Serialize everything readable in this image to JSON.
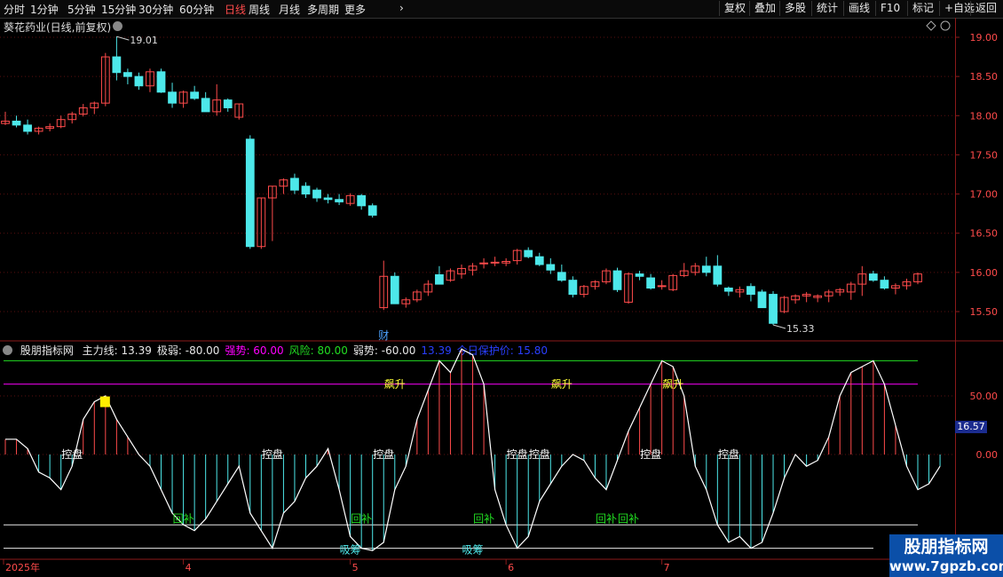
{
  "toolbar": {
    "periods": [
      "分时",
      "1分钟",
      "5分钟",
      "15分钟",
      "30分钟",
      "60分钟",
      "日线",
      "周线",
      "月线",
      "多周期",
      "更多"
    ],
    "active_period": "日线",
    "more_icon": "chevron-right-icon",
    "buttons": [
      "复权",
      "叠加",
      "多股",
      "统计",
      "画线",
      "F10",
      "标记",
      "+自选",
      "返回"
    ]
  },
  "stock": {
    "title": "葵花药业(日线,前复权)",
    "high_label": "19.01",
    "low_label": "15.33",
    "event_label": "财"
  },
  "indicator": {
    "name": "股朋指标网",
    "items": [
      {
        "label": "主力线: 13.39",
        "color": "#e8e8e8"
      },
      {
        "label": "极弱: -80.00",
        "color": "#e8e8e8"
      },
      {
        "label": "强势: 60.00",
        "color": "#ff00ff"
      },
      {
        "label": "风险: 80.00",
        "color": "#22dd22"
      },
      {
        "label": "弱势: -60.00",
        "color": "#e8e8e8"
      },
      {
        "label": "13.39",
        "color": "#2a3fff"
      },
      {
        "label": "今日保护价: 15.80",
        "color": "#2a3fff"
      }
    ],
    "current_value_badge": "16.57",
    "signal_labels": [
      {
        "text": "控盘",
        "i": 6,
        "color": "#ffffff",
        "row": "ctrl"
      },
      {
        "text": "控盘",
        "i": 24,
        "color": "#ffffff",
        "row": "ctrl"
      },
      {
        "text": "控盘",
        "i": 34,
        "color": "#ffffff",
        "row": "ctrl"
      },
      {
        "text": "控盘",
        "i": 46,
        "color": "#ffffff",
        "row": "ctrl"
      },
      {
        "text": "控盘",
        "i": 48,
        "color": "#ffffff",
        "row": "ctrl"
      },
      {
        "text": "控盘",
        "i": 58,
        "color": "#ffffff",
        "row": "ctrl"
      },
      {
        "text": "控盘",
        "i": 65,
        "color": "#ffffff",
        "row": "ctrl"
      },
      {
        "text": "回补",
        "i": 16,
        "color": "#22dd22",
        "row": "hb"
      },
      {
        "text": "回补",
        "i": 32,
        "color": "#22dd22",
        "row": "hb"
      },
      {
        "text": "回补",
        "i": 43,
        "color": "#22dd22",
        "row": "hb"
      },
      {
        "text": "回补",
        "i": 54,
        "color": "#22dd22",
        "row": "hb"
      },
      {
        "text": "回补",
        "i": 56,
        "color": "#22dd22",
        "row": "hb"
      },
      {
        "text": "吸筹",
        "i": 31,
        "color": "#4de8ea",
        "row": "xc"
      },
      {
        "text": "吸筹",
        "i": 42,
        "color": "#4de8ea",
        "row": "xc"
      },
      {
        "text": "飙升",
        "i": 35,
        "color": "#ffff33",
        "row": "bs"
      },
      {
        "text": "飙升",
        "i": 50,
        "color": "#ffff33",
        "row": "bs"
      },
      {
        "text": "飙升",
        "i": 60,
        "color": "#ffff33",
        "row": "bs"
      }
    ]
  },
  "x_axis": {
    "labels": [
      {
        "text": "2025年",
        "i": 0
      },
      {
        "text": "4",
        "i": 16
      },
      {
        "text": "5",
        "i": 31
      },
      {
        "text": "6",
        "i": 45
      },
      {
        "text": "7",
        "i": 59
      }
    ]
  },
  "watermark": {
    "line1": "股朋指标网",
    "line2": "www.7gpzb.com"
  },
  "colors": {
    "up": "#ff4b4b",
    "down": "#4de8ea",
    "bg": "#000000",
    "grid": "#5a0f0f"
  },
  "chart_data": [
    {
      "type": "candlestick",
      "title": "葵花药业(日线,前复权)",
      "y_ticks": [
        19.0,
        18.5,
        18.0,
        17.5,
        17.0,
        16.5,
        16.0,
        15.5
      ],
      "ylim": [
        15.2,
        19.15
      ],
      "ohlc": [
        [
          17.9,
          18.05,
          17.88,
          17.93
        ],
        [
          17.93,
          18.0,
          17.85,
          17.88
        ],
        [
          17.88,
          17.95,
          17.76,
          17.8
        ],
        [
          17.8,
          17.86,
          17.76,
          17.84
        ],
        [
          17.84,
          17.9,
          17.8,
          17.86
        ],
        [
          17.86,
          18.0,
          17.84,
          17.95
        ],
        [
          17.95,
          18.05,
          17.9,
          18.02
        ],
        [
          18.02,
          18.15,
          17.99,
          18.1
        ],
        [
          18.1,
          18.18,
          18.02,
          18.16
        ],
        [
          18.16,
          18.8,
          18.12,
          18.75
        ],
        [
          18.75,
          19.01,
          18.45,
          18.55
        ],
        [
          18.55,
          18.6,
          18.4,
          18.5
        ],
        [
          18.5,
          18.55,
          18.33,
          18.38
        ],
        [
          18.38,
          18.6,
          18.3,
          18.56
        ],
        [
          18.56,
          18.6,
          18.29,
          18.3
        ],
        [
          18.3,
          18.42,
          18.1,
          18.16
        ],
        [
          18.16,
          18.32,
          18.1,
          18.3
        ],
        [
          18.3,
          18.38,
          18.2,
          18.22
        ],
        [
          18.22,
          18.3,
          18.05,
          18.05
        ],
        [
          18.05,
          18.4,
          18.0,
          18.2
        ],
        [
          18.2,
          18.22,
          18.05,
          18.1
        ],
        [
          17.98,
          18.15,
          17.95,
          18.15
        ],
        [
          17.7,
          17.75,
          16.3,
          16.33
        ],
        [
          16.33,
          16.95,
          16.3,
          16.95
        ],
        [
          16.95,
          17.1,
          16.4,
          17.1
        ],
        [
          17.1,
          17.2,
          17.0,
          17.18
        ],
        [
          17.2,
          17.26,
          17.0,
          17.05
        ],
        [
          17.1,
          17.15,
          16.95,
          17.0
        ],
        [
          17.05,
          17.08,
          16.9,
          16.95
        ],
        [
          16.95,
          17.0,
          16.88,
          16.93
        ],
        [
          16.93,
          17.0,
          16.86,
          16.9
        ],
        [
          16.88,
          17.01,
          16.85,
          16.98
        ],
        [
          16.98,
          17.0,
          16.8,
          16.85
        ],
        [
          16.85,
          16.88,
          16.7,
          16.73
        ],
        [
          15.55,
          16.15,
          15.52,
          15.95
        ],
        [
          15.95,
          16.0,
          15.6,
          15.6
        ],
        [
          15.6,
          15.68,
          15.55,
          15.65
        ],
        [
          15.65,
          15.78,
          15.62,
          15.75
        ],
        [
          15.75,
          15.9,
          15.7,
          15.85
        ],
        [
          15.97,
          16.08,
          15.88,
          15.85
        ],
        [
          15.9,
          16.05,
          15.88,
          16.02
        ],
        [
          15.98,
          16.1,
          15.92,
          16.05
        ],
        [
          16.03,
          16.12,
          15.96,
          16.08
        ],
        [
          16.12,
          16.18,
          16.05,
          16.12
        ],
        [
          16.12,
          16.2,
          16.08,
          16.13
        ],
        [
          16.12,
          16.18,
          16.08,
          16.14
        ],
        [
          16.15,
          16.3,
          16.1,
          16.28
        ],
        [
          16.28,
          16.32,
          16.18,
          16.2
        ],
        [
          16.2,
          16.25,
          16.08,
          16.1
        ],
        [
          16.1,
          16.18,
          15.98,
          16.03
        ],
        [
          16.0,
          16.1,
          15.88,
          15.9
        ],
        [
          15.9,
          15.95,
          15.68,
          15.72
        ],
        [
          15.72,
          15.84,
          15.68,
          15.82
        ],
        [
          15.82,
          15.9,
          15.78,
          15.88
        ],
        [
          15.88,
          16.05,
          15.85,
          16.02
        ],
        [
          16.02,
          16.06,
          15.75,
          15.78
        ],
        [
          15.62,
          16.0,
          15.6,
          15.98
        ],
        [
          15.98,
          16.02,
          15.9,
          15.95
        ],
        [
          15.93,
          15.98,
          15.78,
          15.8
        ],
        [
          15.82,
          15.9,
          15.78,
          15.83
        ],
        [
          15.78,
          15.98,
          15.76,
          15.96
        ],
        [
          15.96,
          16.12,
          15.94,
          16.02
        ],
        [
          16.0,
          16.12,
          15.96,
          16.08
        ],
        [
          16.08,
          16.2,
          15.95,
          16.0
        ],
        [
          16.08,
          16.22,
          15.82,
          15.85
        ],
        [
          15.8,
          15.82,
          15.7,
          15.76
        ],
        [
          15.75,
          15.82,
          15.68,
          15.78
        ],
        [
          15.82,
          15.86,
          15.63,
          15.72
        ],
        [
          15.75,
          15.78,
          15.55,
          15.55
        ],
        [
          15.72,
          15.76,
          15.33,
          15.35
        ],
        [
          15.5,
          15.7,
          15.48,
          15.68
        ],
        [
          15.65,
          15.72,
          15.6,
          15.7
        ],
        [
          15.7,
          15.75,
          15.62,
          15.72
        ],
        [
          15.68,
          15.72,
          15.62,
          15.7
        ],
        [
          15.7,
          15.78,
          15.62,
          15.75
        ],
        [
          15.75,
          15.8,
          15.7,
          15.78
        ],
        [
          15.75,
          15.88,
          15.65,
          15.85
        ],
        [
          15.85,
          16.08,
          15.7,
          15.98
        ],
        [
          15.98,
          16.02,
          15.88,
          15.9
        ],
        [
          15.9,
          15.95,
          15.78,
          15.8
        ],
        [
          15.8,
          15.86,
          15.72,
          15.83
        ],
        [
          15.83,
          15.92,
          15.78,
          15.88
        ],
        [
          15.88,
          16.0,
          15.85,
          15.98
        ]
      ]
    },
    {
      "type": "line",
      "series": [
        {
          "name": "主力线",
          "values": [
            13,
            13,
            5,
            -15,
            -20,
            -30,
            -10,
            30,
            45,
            50,
            30,
            15,
            0,
            -10,
            -30,
            -50,
            -60,
            -65,
            -55,
            -40,
            -25,
            -10,
            -50,
            -65,
            -80,
            -50,
            -40,
            -20,
            -10,
            5,
            -30,
            -70,
            -80,
            -82,
            -75,
            -30,
            -10,
            30,
            55,
            80,
            70,
            90,
            85,
            60,
            -30,
            -60,
            -80,
            -70,
            -40,
            -25,
            -10,
            0,
            -5,
            -20,
            -30,
            -5,
            20,
            40,
            60,
            80,
            75,
            50,
            -10,
            -30,
            -60,
            -75,
            -70,
            -80,
            -75,
            -50,
            -20,
            0,
            -10,
            -5,
            15,
            50,
            70,
            75,
            80,
            60,
            25,
            -10,
            -30,
            -25,
            -10
          ]
        }
      ],
      "y_ticks": [
        50.0,
        0.0
      ],
      "levels": [
        80,
        60,
        -60,
        -80
      ],
      "ylim": [
        -92,
        95
      ]
    }
  ]
}
